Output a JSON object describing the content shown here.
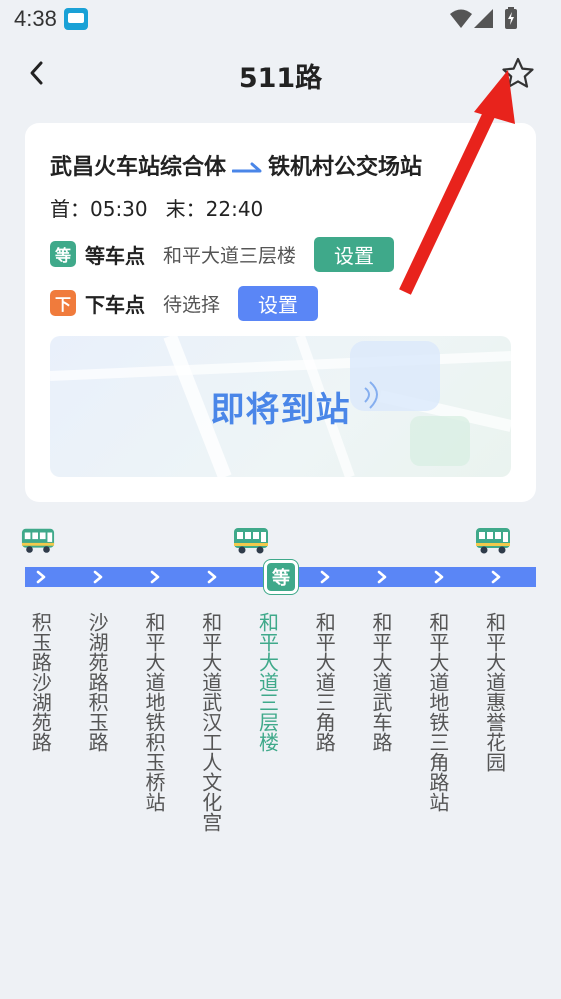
{
  "status_bar": {
    "time": "4:38",
    "icons": [
      "bus-app-icon",
      "wifi-icon",
      "signal-icon",
      "battery-icon"
    ]
  },
  "header": {
    "title": "511路",
    "back_icon": "chevron-left-icon",
    "favorite_icon": "star-outline-icon"
  },
  "route": {
    "from": "武昌火车站综合体",
    "to": "铁机村公交场站",
    "first_bus": "首：05:30",
    "last_bus": "末：22:40"
  },
  "wait_stop": {
    "tag": "等",
    "label": "等车点",
    "value": "和平大道三层楼",
    "button": "设置"
  },
  "alight_stop": {
    "tag": "下",
    "label": "下车点",
    "value": "待选择",
    "button": "设置"
  },
  "arrival": {
    "text": "即将到站"
  },
  "strip": {
    "current_badge": "等",
    "stations": [
      "积玉路沙湖苑路",
      "沙湖苑路积玉路",
      "和平大道地铁积玉桥站",
      "和平大道武汉工人文化宫",
      "和平大道三层楼",
      "和平大道三角路",
      "和平大道武车路",
      "和平大道地铁三角路站",
      "和平大道惠誉花园"
    ],
    "current_index": 4,
    "bus_station_indexes": [
      0,
      3,
      7
    ]
  },
  "colors": {
    "accent_blue": "#5a86f6",
    "accent_green": "#3fa98a",
    "tag_orange": "#f07b3c",
    "annotation_red": "#e8231c",
    "background": "#eef1f5"
  }
}
